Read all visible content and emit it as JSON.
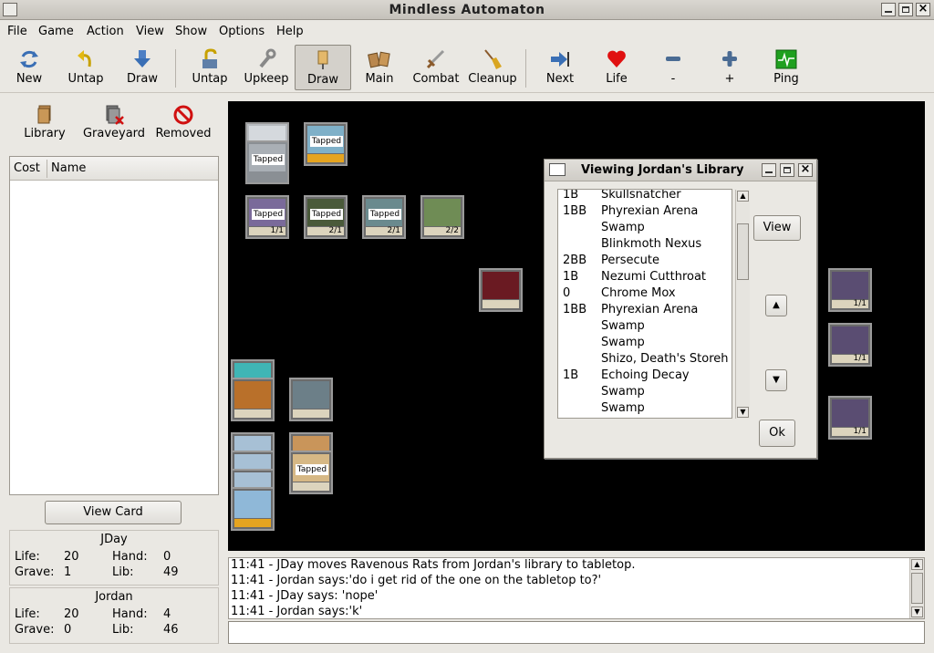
{
  "window": {
    "title": "Mindless Automaton"
  },
  "menu": [
    "File",
    "Game",
    "Action",
    "View",
    "Show",
    "Options",
    "Help"
  ],
  "toolbar": {
    "new": "New",
    "untap1": "Untap",
    "draw1": "Draw",
    "untap2": "Untap",
    "upkeep": "Upkeep",
    "draw2": "Draw",
    "main": "Main",
    "combat": "Combat",
    "cleanup": "Cleanup",
    "next": "Next",
    "life": "Life",
    "minus": "-",
    "plus": "+",
    "ping": "Ping"
  },
  "zones": {
    "library": "Library",
    "graveyard": "Graveyard",
    "removed": "Removed"
  },
  "card_list": {
    "col_cost": "Cost",
    "col_name": "Name"
  },
  "view_card_button": "View Card",
  "players": [
    {
      "name": "JDay",
      "life_label": "Life:",
      "life": "20",
      "hand_label": "Hand:",
      "hand": "0",
      "grave_label": "Grave:",
      "grave": "1",
      "lib_label": "Lib:",
      "lib": "49"
    },
    {
      "name": "Jordan",
      "life_label": "Life:",
      "life": "20",
      "hand_label": "Hand:",
      "hand": "4",
      "grave_label": "Grave:",
      "grave": "0",
      "lib_label": "Lib:",
      "lib": "46"
    }
  ],
  "tabletop_cards": {
    "tapped_label": "Tapped",
    "pt": [
      "1/1",
      "2/1",
      "2/1",
      "2/2",
      "1/1",
      "1/1",
      "1/1"
    ]
  },
  "library_dialog": {
    "title": "Viewing Jordan's Library",
    "view_button": "View",
    "ok_button": "Ok",
    "rows": [
      {
        "cost": "1B",
        "name": "Skullsnatcher"
      },
      {
        "cost": "1BB",
        "name": "Phyrexian Arena"
      },
      {
        "cost": "",
        "name": "Swamp"
      },
      {
        "cost": "",
        "name": "Blinkmoth Nexus"
      },
      {
        "cost": "2BB",
        "name": "Persecute"
      },
      {
        "cost": "1B",
        "name": "Nezumi Cutthroat"
      },
      {
        "cost": "0",
        "name": "Chrome Mox"
      },
      {
        "cost": "1BB",
        "name": "Phyrexian Arena"
      },
      {
        "cost": "",
        "name": "Swamp"
      },
      {
        "cost": "",
        "name": "Swamp"
      },
      {
        "cost": "",
        "name": "Shizo, Death's Storeh"
      },
      {
        "cost": "1B",
        "name": "Echoing Decay"
      },
      {
        "cost": "",
        "name": "Swamp"
      },
      {
        "cost": "",
        "name": "Swamp"
      }
    ]
  },
  "chat": [
    "11:41 - JDay moves Ravenous Rats from Jordan's library to tabletop.",
    "11:41 - Jordan says:'do i get rid of the one on the tabletop to?'",
    "11:41 - JDay says: 'nope'",
    "11:41 - Jordan says:'k'"
  ],
  "colors": {
    "tabletop": "#000000",
    "life_heart": "#e01010",
    "ping": "#1fa01f"
  }
}
